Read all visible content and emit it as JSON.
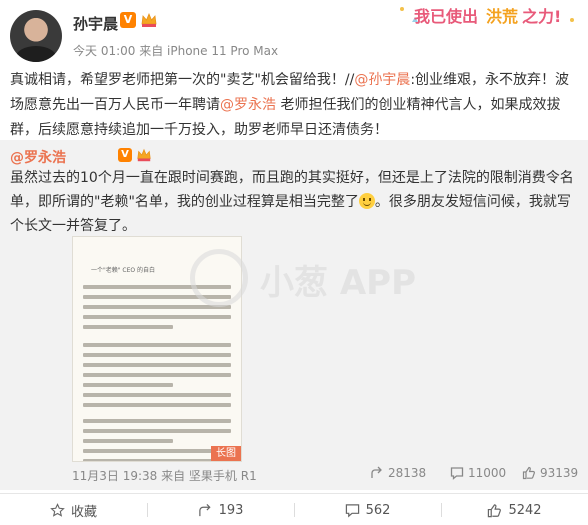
{
  "author": {
    "name": "孙宇晨",
    "verified_mark": "V",
    "meta": "今天 01:00 来自 iPhone 11 Pro Max"
  },
  "banner": {
    "part1": "我已使出",
    "part2": "洪荒",
    "part3": "之力!"
  },
  "post": {
    "text_before": "真诚相请，希望罗老师把第一次的\"卖艺\"机会留给我！//",
    "mention1": "@孙宇晨",
    "text_middle": ":创业维艰，永不放弃！波场愿意先出一百万人民币一年聘请",
    "mention2": "@罗永浩",
    "text_after": " 老师担任我们的创业精神代言人，如果成效拔群，后续愿意持续追加一千万投入，助罗老师早日还清债务！"
  },
  "repost": {
    "user": "@罗永浩",
    "verified_mark": "V",
    "text_before": "虽然过去的10个月一直在跟时间赛跑，而且跑的其实挺好，但还是上了法院的限制消费令名单，即所谓的\"老赖\"名单，我的创业过程算是相当完整了",
    "text_after": "。很多朋友发短信问候，我就写个长文一并答复了。",
    "doc_title": "一个\"老赖\" CEO 的自白",
    "longpic_label": "长图",
    "watermark_text": "小葱 APP",
    "footer_meta": "11月3日 19:38 来自 坚果手机 R1",
    "stats": {
      "shares": "28138",
      "comments": "11000",
      "likes": "93139"
    }
  },
  "actions": {
    "favorite": "收藏",
    "share": "193",
    "comment": "562",
    "like": "5242"
  },
  "colors": {
    "accent": "#eb7350",
    "verified": "#ff8200",
    "repost_bg": "#f2f2f2"
  }
}
